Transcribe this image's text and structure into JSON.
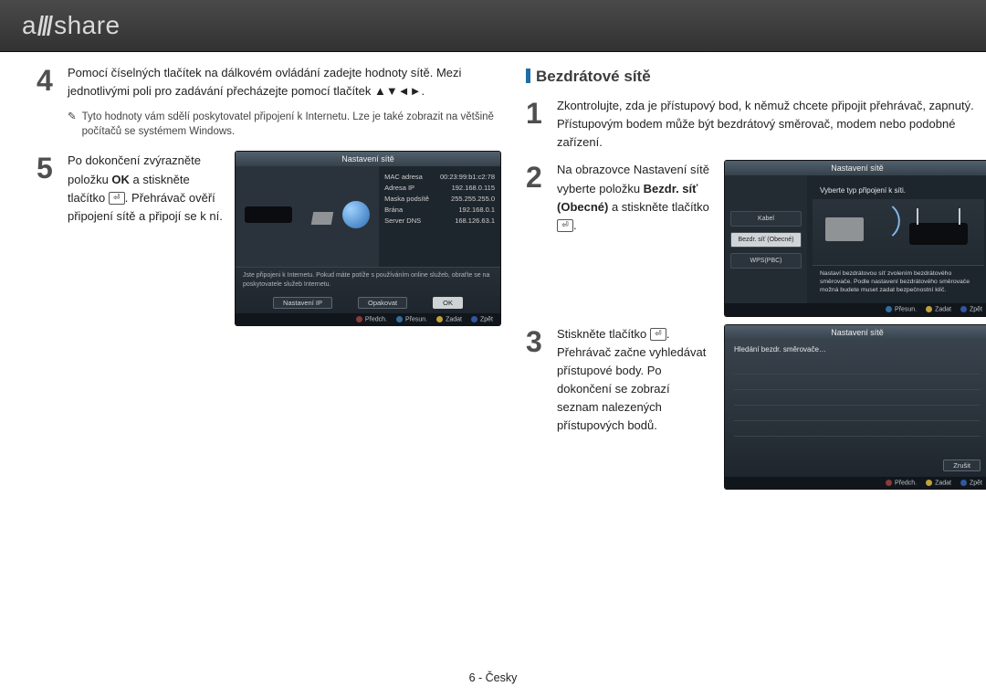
{
  "logo_text_a": "a",
  "logo_text_b": "share",
  "left": {
    "step4": {
      "num": "4",
      "text_a": "Pomocí číselných tlačítek na dálkovém ovládání zadejte hodnoty sítě. Mezi jednotlivými poli pro zadávání přecházejte pomocí tlačítek ",
      "arrows": "▲▼◄►",
      "dot": "."
    },
    "note_icon": "✎",
    "note": "Tyto hodnoty vám sdělí poskytovatel připojení k Internetu. Lze je také zobrazit na většině počítačů se systémem Windows.",
    "step5": {
      "num": "5",
      "txt_a": "Po dokončení zvýrazněte položku ",
      "bold": "OK",
      "txt_b": " a stiskněte tlačítko ",
      "txt_c": ". Přehrávač ověří připojení sítě a připojí se k ní."
    },
    "shot": {
      "title": "Nastavení sítě",
      "kv": [
        {
          "k": "MAC adresa",
          "v": "00:23:99:b1:c2:78"
        },
        {
          "k": "Adresa IP",
          "v": "192.168.0.115"
        },
        {
          "k": "Maska podsítě",
          "v": "255.255.255.0"
        },
        {
          "k": "Brána",
          "v": "192.168.0.1"
        },
        {
          "k": "Server DNS",
          "v": "168.126.63.1"
        }
      ],
      "msg": "Jste připojeni k Internetu. Pokud máte potíže s používáním online služeb, obraťte se na poskytovatele služeb Internetu.",
      "btns": {
        "a": "Nastavení IP",
        "b": "Opakovat",
        "c": "OK"
      },
      "foot": {
        "a": "Předch.",
        "b": "Přesun.",
        "c": "Zadat",
        "d": "Zpět"
      }
    }
  },
  "right": {
    "h2": "Bezdrátové sítě",
    "step1": {
      "num": "1",
      "text": "Zkontrolujte, zda je přístupový bod, k němuž chcete připojit přehrávač, zapnutý. Přístupovým bodem může být bezdrátový směrovač, modem nebo podobné zařízení."
    },
    "step2": {
      "num": "2",
      "txt_a": "Na obrazovce Nastavení sítě vyberte položku ",
      "bold": "Bezdr. síť (Obecné)",
      "txt_b": " a stiskněte tlačítko ",
      "dot": "."
    },
    "shot2": {
      "title": "Nastavení sítě",
      "subtitle": "Vyberte typ připojení k síti.",
      "opts": {
        "a": "Kabel",
        "b": "Bezdr. síť (Obecné)",
        "c": "WPS(PBC)"
      },
      "desc": "Nastaví bezdrátovou síť zvolením bezdrátového směrovače. Podle nastavení bezdrátového směrovače možná budete muset zadat bezpečnostní klíč.",
      "foot": {
        "b": "Přesun.",
        "c": "Zadat",
        "d": "Zpět"
      }
    },
    "step3": {
      "num": "3",
      "txt_a": "Stiskněte tlačítko ",
      "txt_b": ". Přehrávač začne vyhledávat přístupové body. Po dokončení se zobrazí seznam nalezených přístupových bodů."
    },
    "shot3": {
      "title": "Nastavení sítě",
      "search": "Hledání bezdr. směrovače…",
      "cancel": "Zrušit",
      "foot": {
        "a": "Předch.",
        "c": "Zadat",
        "d": "Zpět"
      }
    }
  },
  "footer": "6 - Česky"
}
